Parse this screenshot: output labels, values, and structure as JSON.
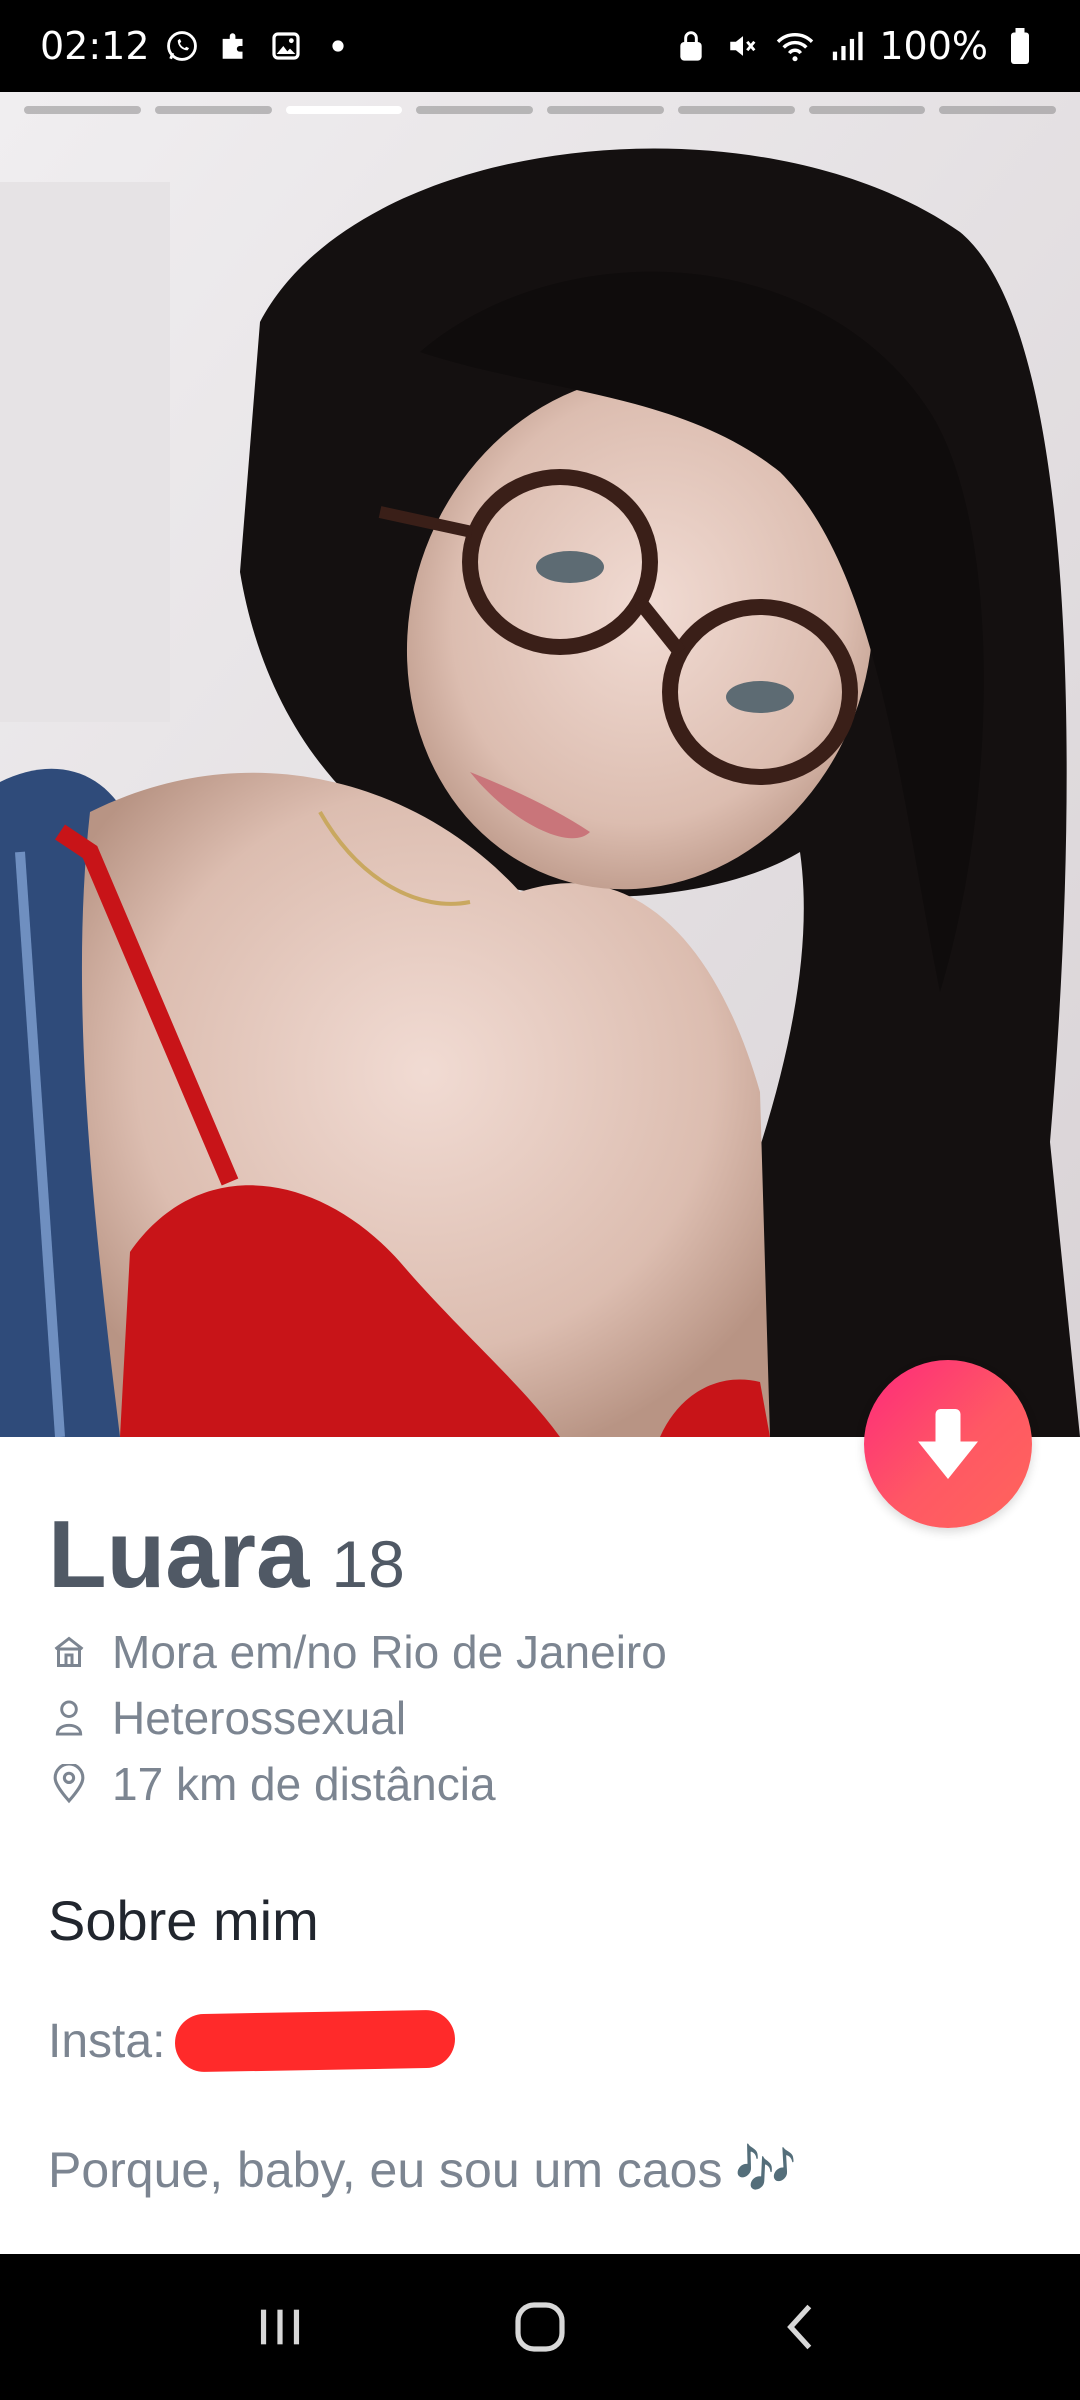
{
  "status_bar": {
    "time": "02:12",
    "battery": "100%",
    "icons": [
      "whatsapp-icon",
      "puzzle-icon",
      "gallery-icon",
      "dot-icon",
      "lock-icon",
      "mute-icon",
      "wifi-icon",
      "signal-icon",
      "battery-icon"
    ]
  },
  "photo": {
    "segments": 8,
    "active_segment": 3
  },
  "profile": {
    "name": "Luara",
    "age": "18",
    "details": [
      {
        "icon": "home-icon",
        "text": "Mora em/no Rio de Janeiro"
      },
      {
        "icon": "person-icon",
        "text": "Heterossexual"
      },
      {
        "icon": "location-pin-icon",
        "text": "17 km de distância"
      }
    ]
  },
  "about": {
    "title": "Sobre mim",
    "insta_label": "Insta:",
    "bio": "Porque, baby, eu sou um caos",
    "bio_emoji": "🎶"
  },
  "colors": {
    "accent_start": "#fd297b",
    "accent_end": "#ff655b",
    "name": "#505965",
    "secondary_text": "#7c8591"
  },
  "nav": {
    "buttons": [
      "recents-icon",
      "home-icon",
      "back-icon"
    ]
  }
}
